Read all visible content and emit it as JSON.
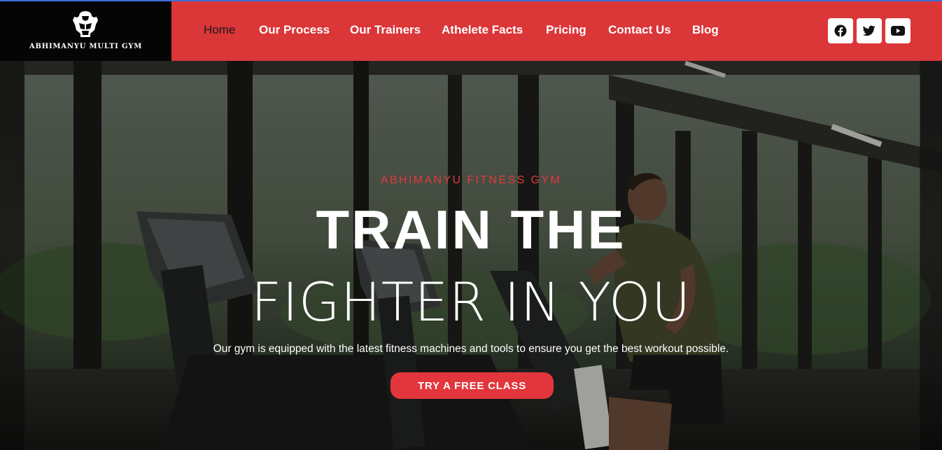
{
  "brand": {
    "name": "ABHIMANYU MULTI GYM",
    "logo_icon": "bodybuilder-logo-icon"
  },
  "nav": {
    "items": [
      {
        "label": "Home",
        "active": true
      },
      {
        "label": "Our Process"
      },
      {
        "label": "Our Trainers"
      },
      {
        "label": "Athelete Facts"
      },
      {
        "label": "Pricing"
      },
      {
        "label": "Contact Us"
      },
      {
        "label": "Blog"
      }
    ]
  },
  "social": [
    {
      "icon": "facebook-icon"
    },
    {
      "icon": "twitter-icon"
    },
    {
      "icon": "youtube-icon"
    }
  ],
  "hero": {
    "eyebrow": "ABHIMANYU FITNESS GYM",
    "title_line1": "TRAIN THE",
    "title_line2": "FIGHTER IN YOU",
    "subtitle": "Our gym is equipped with the latest fitness machines and tools to ensure you get the best workout possible.",
    "cta_label": "TRY A FREE CLASS"
  },
  "colors": {
    "header_red": "#db3638",
    "logo_bg": "#050505",
    "accent_red": "#e3363c",
    "eyebrow_red": "#e23a3d",
    "active_nav": "#1a1a1a"
  }
}
